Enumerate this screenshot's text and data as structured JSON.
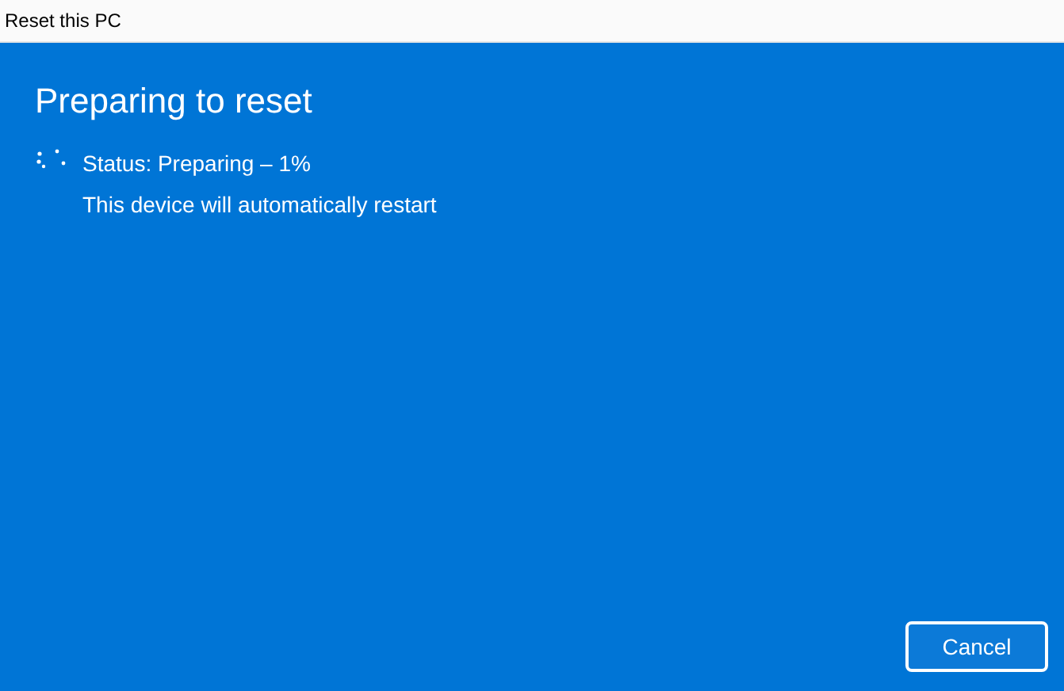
{
  "window": {
    "title": "Reset this PC"
  },
  "heading": "Preparing to reset",
  "status": "Status: Preparing – 1%",
  "note": "This device will automatically restart",
  "buttons": [
    "Cancel"
  ]
}
